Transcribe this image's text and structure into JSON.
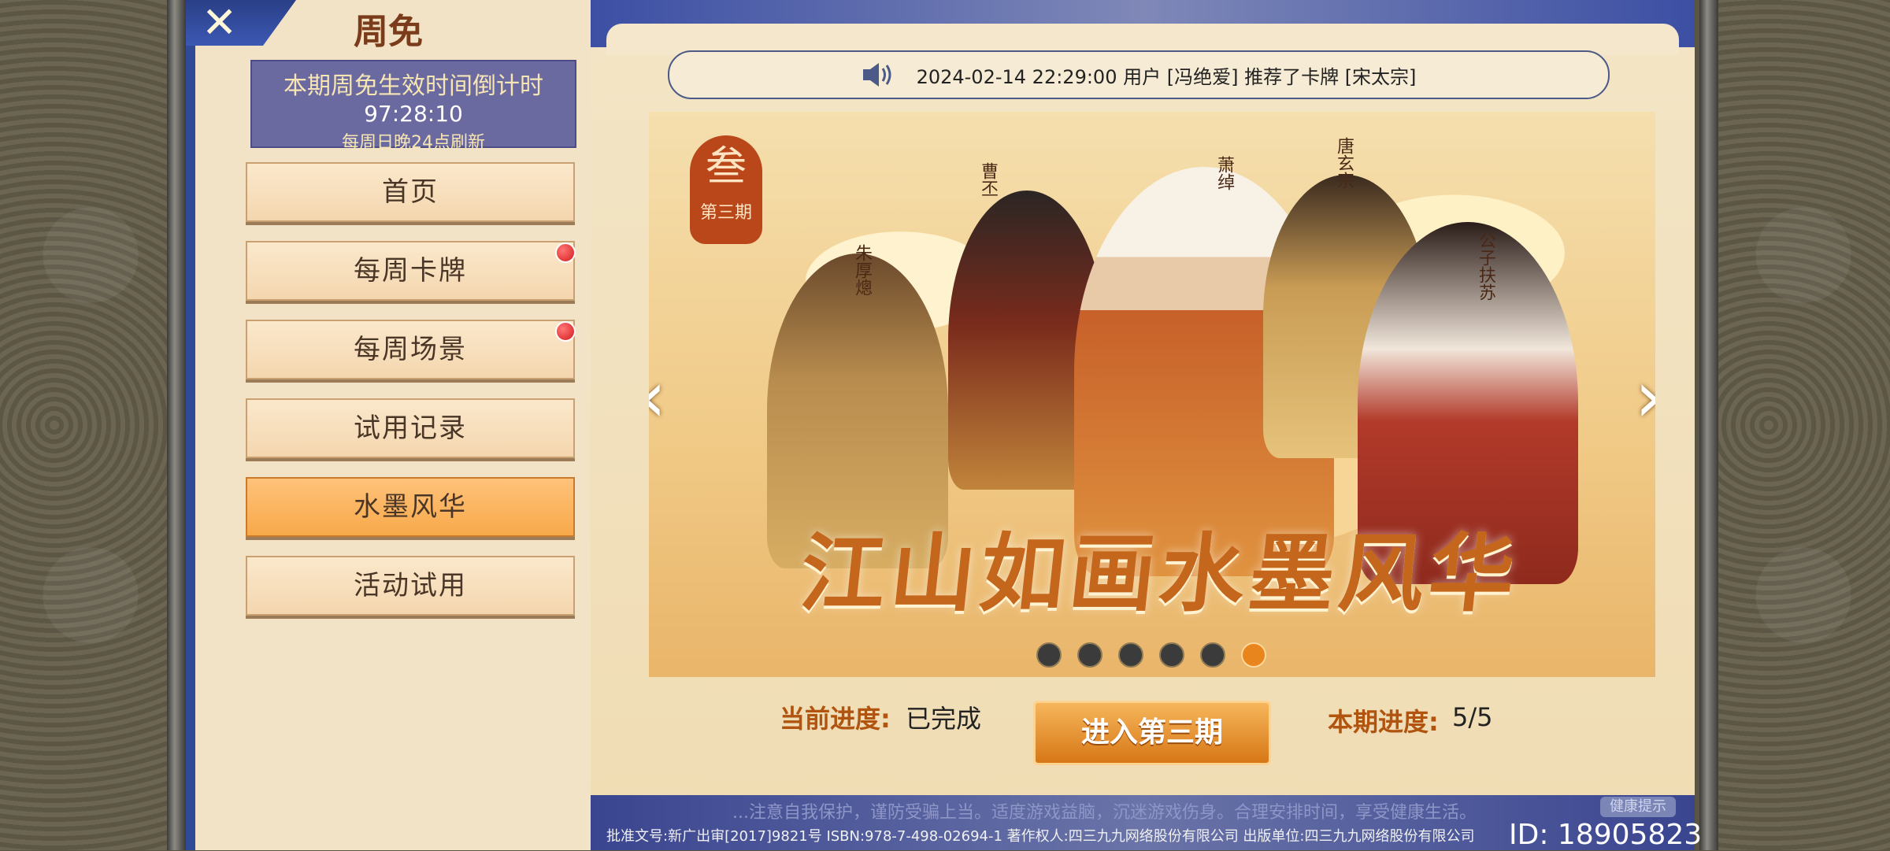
{
  "sidebar": {
    "title": "周免",
    "countdown": {
      "heading": "本期周免生效时间倒计时",
      "time": "97:28:10",
      "refresh_note": "每周日晚24点刷新"
    },
    "items": [
      {
        "label": "首页"
      },
      {
        "label": "每周卡牌"
      },
      {
        "label": "每周场景"
      },
      {
        "label": "试用记录"
      },
      {
        "label": "水墨风华"
      },
      {
        "label": "活动试用"
      }
    ]
  },
  "ticker": {
    "text": "2024-02-14 22:29:00  用户 [冯绝爱] 推荐了卡牌 [宋太宗]"
  },
  "banner": {
    "issue_char": "叁",
    "issue_label": "第三期",
    "characters": [
      "曹丕",
      "萧绰",
      "唐玄宗",
      "朱厚熜",
      "公子扶苏"
    ],
    "calligraphy_title": "江山如画水墨风华",
    "slide_count": 6,
    "active_slide": 6
  },
  "progress": {
    "current_label": "当前进度:",
    "current_value": "已完成",
    "enter_button": "进入第三期",
    "period_label": "本期进度:",
    "period_value": "5/5"
  },
  "footer": {
    "health_notice": "...注意自我保护，谨防受骗上当。适度游戏益脑，沉迷游戏伤身。合理安排时间，享受健康生活。",
    "health_button": "健康提示",
    "isbn_line": "批准文号:新广出审[2017]9821号  ISBN:978-7-498-02694-1  著作权人:四三九九网络股份有限公司  出版单位:四三九九网络股份有限公司",
    "user_id": "ID: 18905823"
  },
  "colors": {
    "accent_orange": "#e8861d",
    "sidebar_blue": "#2f4b98",
    "countdown_bg": "#6a6aa1"
  }
}
